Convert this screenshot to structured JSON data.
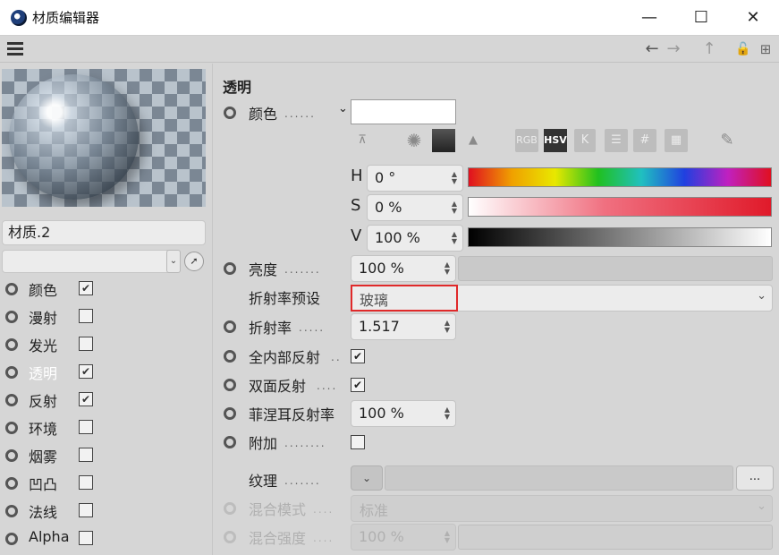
{
  "window": {
    "title": "材质编辑器",
    "minimize": "—",
    "maximize": "☐",
    "close": "✕"
  },
  "nav": {
    "back": "←",
    "forward": "→",
    "up": "↑",
    "lock": "🔓",
    "newwin": "⊞"
  },
  "material": {
    "name": "材质.2"
  },
  "channels": [
    {
      "label": "颜色",
      "checked": "✔",
      "active": false
    },
    {
      "label": "漫射",
      "checked": "",
      "active": false
    },
    {
      "label": "发光",
      "checked": "",
      "active": false
    },
    {
      "label": "透明",
      "checked": "✔",
      "active": true
    },
    {
      "label": "反射",
      "checked": "✔",
      "active": false
    },
    {
      "label": "环境",
      "checked": "",
      "active": false
    },
    {
      "label": "烟雾",
      "checked": "",
      "active": false
    },
    {
      "label": "凹凸",
      "checked": "",
      "active": false
    },
    {
      "label": "法线",
      "checked": "",
      "active": false
    },
    {
      "label": "Alpha",
      "checked": "",
      "active": false
    }
  ],
  "panel": {
    "section_title": "透明",
    "color_label": "颜色",
    "color_value": "#ffffff",
    "picker_modes": [
      "RGB",
      "HSV",
      "K",
      "#"
    ],
    "h_label": "H",
    "h_value": "0 °",
    "s_label": "S",
    "s_value": "0 %",
    "v_label": "V",
    "v_value": "100 %",
    "brightness_label": "亮度",
    "brightness_value": "100 %",
    "ior_preset_label": "折射率预设",
    "ior_preset_value": "玻璃",
    "ior_label": "折射率",
    "ior_value": "1.517",
    "total_internal_label": "全内部反射",
    "total_internal_checked": "✔",
    "double_sided_label": "双面反射",
    "double_sided_checked": "✔",
    "fresnel_label": "菲涅耳反射率",
    "fresnel_value": "100 %",
    "additive_label": "附加",
    "additive_checked": "",
    "texture_label": "纹理",
    "texture_more": "...",
    "blend_mode_label": "混合模式",
    "blend_mode_value": "标准",
    "blend_strength_label": "混合强度",
    "blend_strength_value": "100 %"
  },
  "colors": {
    "highlight_border": "#e0292a",
    "active_channel_text": "#ffffff"
  }
}
